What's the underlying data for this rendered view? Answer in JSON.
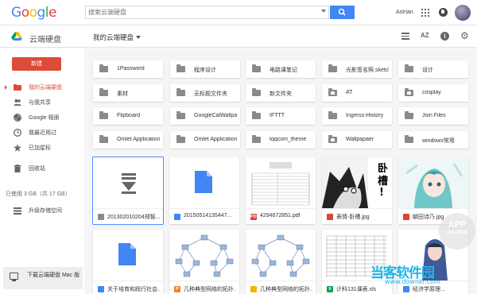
{
  "header": {
    "logo": "Google",
    "logo_colors": [
      "#4285f4",
      "#ea4335",
      "#fbbc05",
      "#4285f4",
      "#34a853",
      "#ea4335"
    ],
    "search_placeholder": "搜索云端硬盘",
    "user_name": "Astrian"
  },
  "toolbar": {
    "app_title": "云端硬盘",
    "location": "我的云端硬盘",
    "sort_label": "AZ",
    "info_label": "i",
    "settings_label": "⚙"
  },
  "sidebar": {
    "new_button": "新建",
    "items": [
      {
        "label": "我的云端硬盘",
        "icon": "drive-folder-icon",
        "active": true
      },
      {
        "label": "与我共享",
        "icon": "people-icon",
        "active": false
      },
      {
        "label": "Google 相册",
        "icon": "photos-pinwheel-icon",
        "active": false
      },
      {
        "label": "我最近用过",
        "icon": "clock-icon",
        "active": false
      },
      {
        "label": "已加星标",
        "icon": "star-icon",
        "active": false
      },
      {
        "label": "回收站",
        "icon": "trash-icon",
        "active": false
      }
    ],
    "storage_text": "已使用 3 GB（共 17 GB）",
    "upgrade_label": "升级存储空间",
    "mac_download": "下载云端硬盘 Mac 版"
  },
  "folders": [
    {
      "name": "1Password",
      "shared": false
    },
    {
      "name": "程序设计",
      "shared": false
    },
    {
      "name": "电路课笔记",
      "shared": false
    },
    {
      "name": "光影签名照.sketch",
      "shared": false
    },
    {
      "name": "设计",
      "shared": false
    },
    {
      "name": "素材",
      "shared": false
    },
    {
      "name": "无标题文件夹",
      "shared": false
    },
    {
      "name": "新文件夹",
      "shared": false
    },
    {
      "name": "AT",
      "shared": true
    },
    {
      "name": "cosplay",
      "shared": true
    },
    {
      "name": "Flipboard",
      "shared": false
    },
    {
      "name": "GoogleCalWallpaper",
      "shared": false
    },
    {
      "name": "IFTTT",
      "shared": false
    },
    {
      "name": "Ingress-History",
      "shared": false
    },
    {
      "name": "Join Files",
      "shared": false
    },
    {
      "name": "Omlet Applications",
      "shared": false
    },
    {
      "name": "Omlet Applications",
      "shared": false
    },
    {
      "name": "tqqcom_theme",
      "shared": false
    },
    {
      "name": "Wallpapaer",
      "shared": true
    },
    {
      "name": "windows常用",
      "shared": false
    }
  ],
  "files": [
    {
      "name": "201302010204郑智...",
      "type": "file",
      "type_badge": "",
      "type_color": "#8a8a8a"
    },
    {
      "name": "20150514135447...",
      "type": "doc",
      "type_badge": "",
      "type_color": "#4285f4"
    },
    {
      "name": "4294672851.pdf",
      "type": "pdf",
      "type_badge": "PDF",
      "type_color": "#db4437"
    },
    {
      "name": "表情-卧槽.jpg",
      "type": "image",
      "type_badge": "",
      "type_color": "#db4437"
    },
    {
      "name": "朝田诗乃.jpg",
      "type": "image",
      "type_badge": "",
      "type_color": "#db4437"
    },
    {
      "name": "关于培育和践行社会...",
      "type": "doc",
      "type_badge": "",
      "type_color": "#4285f4"
    },
    {
      "name": "几种典型网络的拓扑...",
      "type": "ppt",
      "type_badge": "P",
      "type_color": "#f4811f"
    },
    {
      "name": "几种典型网络的拓扑...",
      "type": "slides",
      "type_badge": "",
      "type_color": "#f4b400"
    },
    {
      "name": "计科131课表.xls",
      "type": "xls",
      "type_badge": "X",
      "type_color": "#0f9d58"
    },
    {
      "name": "经济学原理...",
      "type": "doc",
      "type_badge": "",
      "type_color": "#4285f4"
    }
  ],
  "manga_text": "卧槽!",
  "watermarks": {
    "app_solution": "APP",
    "app_solution_sub": "SOLUTION",
    "site_cn": "当客软件园",
    "site_url": "www.downkr.com"
  }
}
